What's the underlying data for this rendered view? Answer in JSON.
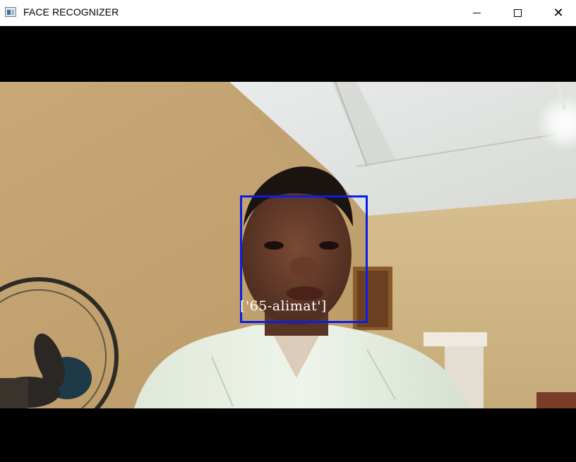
{
  "window": {
    "title": "FACE RECOGNIZER",
    "icon": "app-window-icon",
    "controls": {
      "minimize_icon": "minimize-icon",
      "maximize_icon": "maximize-icon",
      "close_icon": "close-icon",
      "close_glyph": "✕"
    }
  },
  "video": {
    "detection": {
      "label": "['65-alimat']",
      "box_color": "#0a1ee8",
      "label_color": "#ffffff"
    }
  }
}
